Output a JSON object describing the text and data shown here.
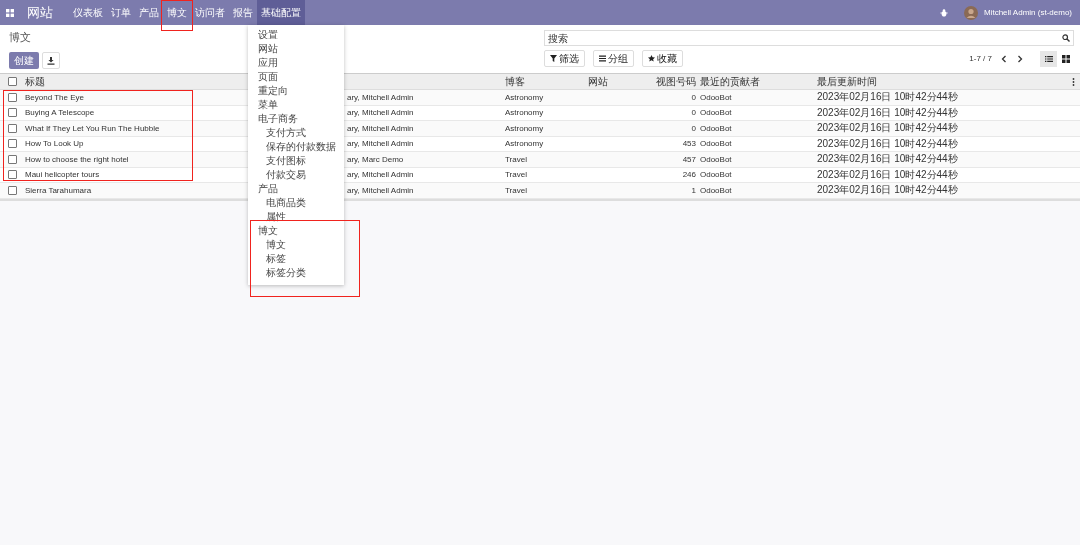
{
  "navbar": {
    "app_name": "网站",
    "menus": [
      {
        "label": "仪表板",
        "open": false,
        "highlighted": false
      },
      {
        "label": "订单",
        "open": false,
        "highlighted": false
      },
      {
        "label": "产品",
        "open": false,
        "highlighted": false
      },
      {
        "label": "博文",
        "open": false,
        "highlighted": true
      },
      {
        "label": "访问者",
        "open": false,
        "highlighted": false
      },
      {
        "label": "报告",
        "open": false,
        "highlighted": false
      },
      {
        "label": "基础配置",
        "open": true,
        "highlighted": false
      }
    ],
    "user": "Mitchell Admin (st-demo)"
  },
  "dropdown": {
    "sections": [
      {
        "items": [
          "设置",
          "网站",
          "应用",
          "页面",
          "重定向",
          "菜单"
        ],
        "highlighted": false
      },
      {
        "label": "电子商务",
        "items": [
          "支付方式",
          "保存的付款数据",
          "支付图标",
          "付款交易"
        ],
        "highlighted": false
      },
      {
        "label": "产品",
        "items": [
          "电商品类",
          "属性"
        ],
        "highlighted": false
      },
      {
        "label": "博文",
        "items": [
          "博文",
          "标签",
          "标签分类"
        ],
        "highlighted": true
      }
    ]
  },
  "control_panel": {
    "title": "博文",
    "create_button": "创建",
    "search": {
      "placeholder": "搜索"
    },
    "filters": [
      {
        "kind": "filter",
        "label": "筛选"
      },
      {
        "kind": "group",
        "label": "分组"
      },
      {
        "kind": "favorite",
        "label": "收藏"
      }
    ],
    "pager": "1-7 / 7",
    "views": [
      {
        "kind": "list",
        "selected": true
      },
      {
        "kind": "kanban",
        "selected": false
      }
    ]
  },
  "table": {
    "title_column_highlighted": true,
    "select_all_checked": false,
    "columns": [
      "标题",
      "博客",
      "网站",
      "视图号码",
      "最近的贡献者",
      "最后更新时间"
    ],
    "rows": [
      {
        "checked": false,
        "title": "Beyond The Eye",
        "column_2": "ary, Mitchell Admin",
        "blog": "Astronomy",
        "views": "0",
        "contributor": "OdooBot",
        "updated": "2023年02月16日 10时42分44秒"
      },
      {
        "checked": false,
        "title": "Buying A Telescope",
        "column_2": "ary, Mitchell Admin",
        "blog": "Astronomy",
        "views": "0",
        "contributor": "OdooBot",
        "updated": "2023年02月16日 10时42分44秒"
      },
      {
        "checked": false,
        "title": "What If They Let You Run The Hubble",
        "column_2": "ary, Mitchell Admin",
        "blog": "Astronomy",
        "views": "0",
        "contributor": "OdooBot",
        "updated": "2023年02月16日 10时42分44秒"
      },
      {
        "checked": false,
        "title": "How To Look Up",
        "column_2": "ary, Mitchell Admin",
        "blog": "Astronomy",
        "views": "453",
        "contributor": "OdooBot",
        "updated": "2023年02月16日 10时42分44秒"
      },
      {
        "checked": false,
        "title": "How to choose the right hotel",
        "column_2": "ary, Marc Demo",
        "blog": "Travel",
        "views": "457",
        "contributor": "OdooBot",
        "updated": "2023年02月16日 10时42分44秒"
      },
      {
        "checked": false,
        "title": "Maui helicopter tours",
        "column_2": "ary, Mitchell Admin",
        "blog": "Travel",
        "views": "246",
        "contributor": "OdooBot",
        "updated": "2023年02月16日 10时42分44秒"
      },
      {
        "checked": false,
        "title": "Sierra Tarahumara",
        "column_2": "ary, Mitchell Admin",
        "blog": "Travel",
        "views": "1",
        "contributor": "OdooBot",
        "updated": "2023年02月16日 10时42分44秒"
      }
    ]
  }
}
